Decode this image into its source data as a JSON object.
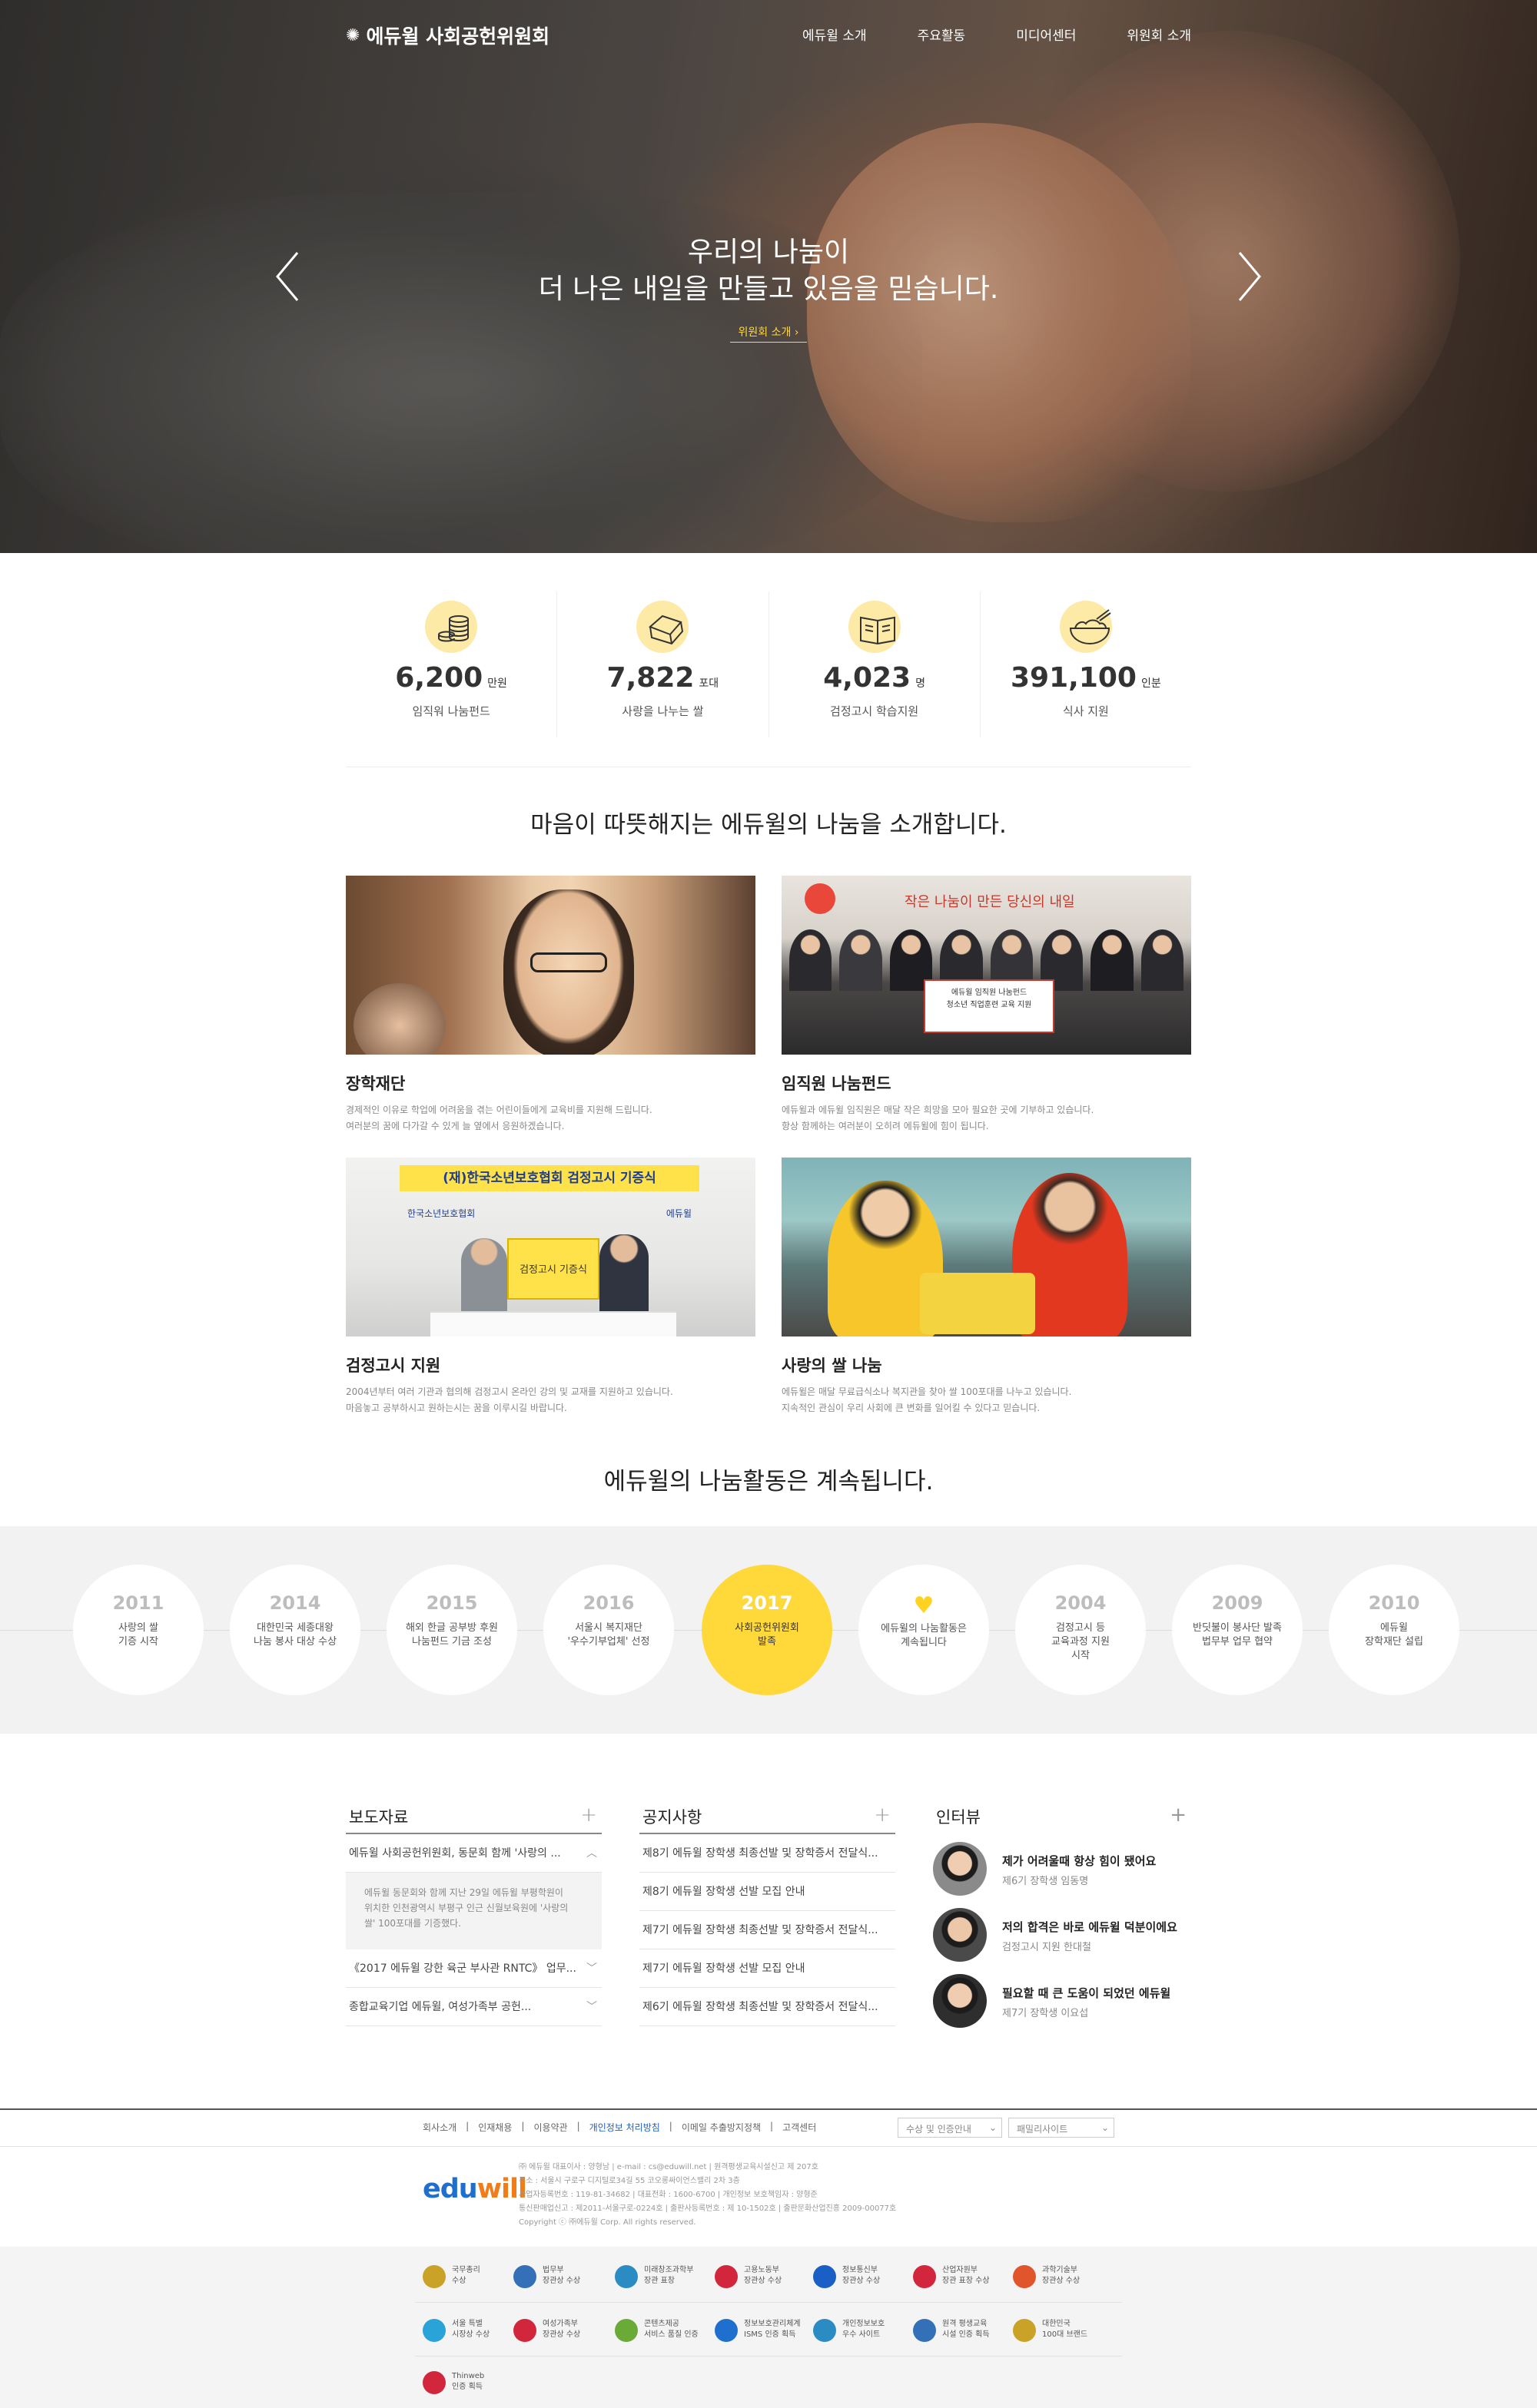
{
  "header": {
    "logo_text": "에듀윌 사회공헌위원회",
    "menu": [
      "에듀윌 소개",
      "주요활동",
      "미디어센터",
      "위원회 소개"
    ]
  },
  "hero": {
    "line1": "우리의 나눔이",
    "line2": "더 나은 내일을 만들고 있음을 믿습니다.",
    "link": "위원회 소개"
  },
  "stats": [
    {
      "value": "6,200",
      "unit": "만원",
      "label": "임직워 나눔펀드",
      "icon": "coins-icon"
    },
    {
      "value": "7,822",
      "unit": "포대",
      "label": "사랑을 나누는 쌀",
      "icon": "rice-bag-icon"
    },
    {
      "value": "4,023",
      "unit": "명",
      "label": "검정고시 학습지원",
      "icon": "book-icon"
    },
    {
      "value": "391,100",
      "unit": "인분",
      "label": "식사 지원",
      "icon": "rice-bowl-icon"
    }
  ],
  "intro_title": "마음이 따뜻해지는 에듀윌의 나눔을 소개합니다.",
  "cards": [
    {
      "title": "장학재단",
      "desc1": "경제적인 이유로 학업에 어려움을 겪는 어린이들에게 교육비를 지원해 드립니다.",
      "desc2": "여러분의 꿈에 다가갈 수 있게 늘 옆에서 응원하겠습니다."
    },
    {
      "title": "임직원 나눔펀드",
      "desc1": "에듀윌과 에듀윌 임직원은 매달 작은 희망을 모아 필요한 곳에 기부하고 있습니다.",
      "desc2": "항상 함께하는 여러분이 오히려 에듀윌에 힘이 됩니다."
    },
    {
      "title": "검정고시 지원",
      "desc1": "2004년부터 여러 기관과 협의해 검정고시 온라인 강의 및 교재를 지원하고 있습니다.",
      "desc2": "마음놓고 공부하시고 원하는시는 꿈을 이루시길 바랍니다."
    },
    {
      "title": "사랑의 쌀 나눔",
      "desc1": "에듀윌은 매달 무료급식소나 복지관을 찾아 쌀 100포대를 나누고 있습니다.",
      "desc2": "지속적인 관심이 우리 사회에 큰 변화를 일어킬 수 있다고 믿습니다."
    }
  ],
  "card_images": {
    "banner1": "(재)한국소년보호협회 검정고시 기증식",
    "banner1_sub": "검정고시 기증식",
    "banner2_org": "한국소년보호협회",
    "banner2_brand": "에듀윌",
    "sign1": "에듀윌 임직원 나눔펀드",
    "sign2": "청소년 직업훈련 교육 지원",
    "wall_text": "작은 나눔이 만든 당신의 내일"
  },
  "timeline_title": "에듀윌의 나눔활동은 계속됩니다.",
  "timeline": [
    {
      "year": "2011",
      "text": [
        "사랑의 쌀",
        "기증 시작"
      ]
    },
    {
      "year": "2014",
      "text": [
        "대한민국 세종대왕",
        "나눔 봉사 대상 수상"
      ]
    },
    {
      "year": "2015",
      "text": [
        "해외 한글 공부방 후원",
        "나눔펀드 기금 조성"
      ]
    },
    {
      "year": "2016",
      "text": [
        "서울시 복지재단",
        "'우수기부업체' 선정"
      ]
    },
    {
      "year": "2017",
      "text": [
        "사회공헌위원회",
        "발족"
      ],
      "active": true
    },
    {
      "year": "♥",
      "text": [
        "에듀윌의 나눔활동은",
        "계속됩니다"
      ],
      "heart": true
    },
    {
      "year": "2004",
      "text": [
        "검정고시 등",
        "교육과정 지원",
        "시작"
      ]
    },
    {
      "year": "2009",
      "text": [
        "반딧불이 봉사단 발족",
        "법무부 업무 협약"
      ]
    },
    {
      "year": "2010",
      "text": [
        "에듀윌",
        "장학재단 설립"
      ]
    }
  ],
  "press": {
    "title": "보도자료",
    "rows": [
      "에듀윌 사회공헌위원회, 동문회 함께 '사랑의 ...",
      "《2017 에듀윌 강한 육군 부사관 RNTC》 업무...",
      "종합교육기업 에듀윌, 여성가족부 공헌..."
    ],
    "expanded": [
      "에듀윌 동문회와 함께 지난 29일 에듀윌 부평학원이",
      "위치한 인천광역시 부평구 인근 신월보육원에 '사랑의",
      "쌀' 100포대를 기증했다."
    ]
  },
  "notice": {
    "title": "공지사항",
    "rows": [
      "제8기 에듀윌 장학생 최종선발 및 장학증서 전달식...",
      "제8기 에듀윌 장학생 선발 모집 안내",
      "제7기 에듀윌 장학생 최종선발 및 장학증서 전달식...",
      "제7기 에듀윌 장학생 선발 모집 안내",
      "제6기 에듀윌 장학생 최종선발 및 장학증서 전달식..."
    ]
  },
  "interview": {
    "title": "인터뷰",
    "items": [
      {
        "quote": "제가 어려울때 항상 힘이 됐어요",
        "who": "제6기 장학생 임동명"
      },
      {
        "quote": "저의 합격은 바로 에듀윌 덕분이에요",
        "who": "검정고시 지원 한대철"
      },
      {
        "quote": "필요할 때 큰 도움이 되었던 에듀윌",
        "who": "제7기 장학생 이요섭"
      }
    ]
  },
  "footer": {
    "links": [
      "회사소개",
      "인재채용",
      "이용약관",
      "개인정보 처리방침",
      "이메일 추출방지정책",
      "고객센터"
    ],
    "select1": "수상 및 인증안내",
    "select2": "패밀리사이트",
    "logo_edu": "edu",
    "logo_will": "will",
    "info": [
      "㈜ 에듀윌 대표이사 : 양형남 | e-mail : cs@eduwill.net | 원격평생교육시설신고 제 207호",
      "주소 : 서울시 구로구 디지털로34길 55 코오롱싸이언스밸리 2차 3층",
      "사업자등록번호 : 119-81-34682 | 대표전화 : 1600-6700 | 개인정보 보호책임자 : 양형준",
      "통신판매업신고 : 제2011-서울구로-0224호 | 출판사등록번호 : 제 10-1502호 | 출판문화산업진흥 2009-00077호",
      "Copyright ⓒ ㈜에듀윌 Corp. All rights reserved."
    ]
  },
  "awards": [
    {
      "l1": "국무총리",
      "l2": "수상",
      "color": "#c9a227"
    },
    {
      "l1": "법무부",
      "l2": "장관상 수상",
      "color": "#3470b8"
    },
    {
      "l1": "미래창조과학부",
      "l2": "장관 표창",
      "color": "#2b8cc4"
    },
    {
      "l1": "고용노동부",
      "l2": "장관상 수상",
      "color": "#d1263b"
    },
    {
      "l1": "정보통신부",
      "l2": "장관상 수상",
      "color": "#1a5fc6"
    },
    {
      "l1": "산업자원부",
      "l2": "장관 표창 수상",
      "color": "#d1263b"
    },
    {
      "l1": "과학기술부",
      "l2": "장관상 수상",
      "color": "#e0552c"
    },
    {
      "l1": "서울 특별",
      "l2": "시장상 수상",
      "color": "#2aa3d8"
    },
    {
      "l1": "여성가족부",
      "l2": "장관상 수상",
      "color": "#d1263b"
    },
    {
      "l1": "콘텐츠제공",
      "l2": "서비스 품질 인증",
      "color": "#6aab38"
    },
    {
      "l1": "정보보호관리체계",
      "l2": "ISMS 인증 획득",
      "color": "#1f6fcf"
    },
    {
      "l1": "개인정보보호",
      "l2": "우수 사이트",
      "color": "#2b8cc4"
    },
    {
      "l1": "원격 평생교육",
      "l2": "시설 인증 획득",
      "color": "#3470b8"
    },
    {
      "l1": "대한민국",
      "l2": "100대 브랜드",
      "color": "#c9a227"
    },
    {
      "l1": "Thinweb",
      "l2": "인증 획득",
      "color": "#d1263b"
    }
  ]
}
